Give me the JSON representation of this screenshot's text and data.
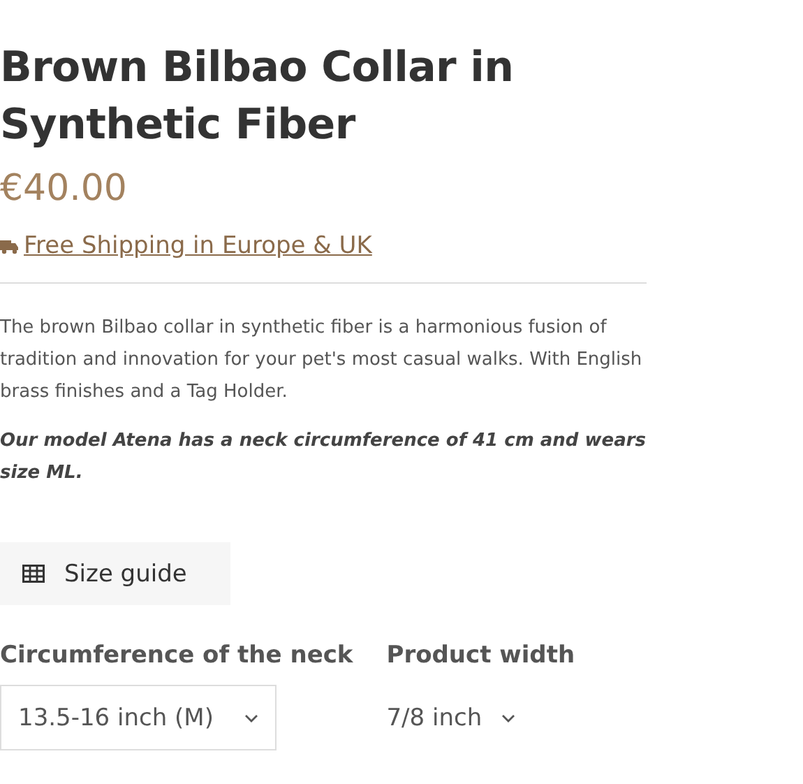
{
  "product": {
    "title": "Brown Bilbao Collar in Synthetic Fiber",
    "price": "€40.00"
  },
  "shipping": {
    "label": "Free Shipping in Europe & UK"
  },
  "description": "The brown Bilbao collar in synthetic fiber is a harmonious fusion of tradition and innovation for your pet's most casual walks. With English brass finishes and a Tag Holder.",
  "model_note": "Our model Atena has a neck circumference of 41 cm and wears size ML.",
  "size_guide": {
    "label": "Size guide"
  },
  "options": [
    {
      "label": "Circumference of the neck",
      "value": "13.5-16 inch (M)",
      "kind": "boxed"
    },
    {
      "label": "Product width",
      "value": "7/8 inch",
      "kind": "plain"
    }
  ]
}
